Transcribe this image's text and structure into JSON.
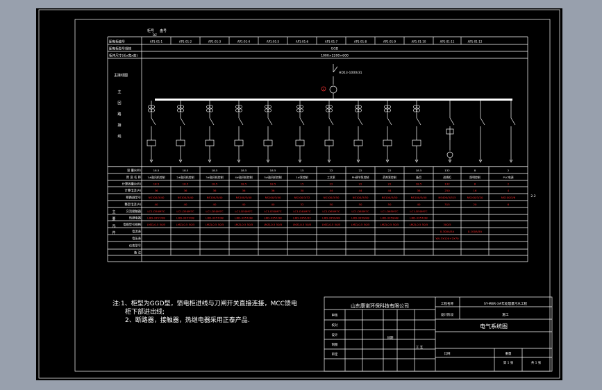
{
  "colors": {
    "background": "#000000",
    "frame": "#ffffff",
    "text": "#ffffff",
    "values": "#ff2a2a",
    "accent": "#ff3333",
    "desktop": "#98a0ad"
  },
  "header": {
    "cabinet_no_label": "柜号",
    "panel_no_label": "盘号",
    "code": "DZ",
    "row1_label": "配电柜编号",
    "row2_label": "配电柜型号规格",
    "row2_value": "GGD",
    "row3_label": "柜体尺寸(长x宽x高)",
    "row3_value": "1000×2200×600",
    "cabinet_ids": [
      "AP1-01-1",
      "AP1-01-2",
      "AP1-01-3",
      "AP1-01-4",
      "AP1-01-5",
      "AP1-01-6",
      "AP1-01-7",
      "AP1-01-8",
      "AP1-01-9",
      "AP1-01-10",
      "AP1-01-11",
      "AP1-01-12"
    ]
  },
  "diagram": {
    "main_label": "主接线图",
    "side_labels": [
      "主",
      "回",
      "路",
      "接",
      "线"
    ],
    "main_switch": "HD13-1000/31",
    "meter_label": "A"
  },
  "table": {
    "rows": [
      {
        "label": "容 量(kW)",
        "values": [
          "18.5",
          "18.5",
          "18.5",
          "18.5",
          "18.5",
          "15",
          "22",
          "22",
          "22",
          "18.5",
          "132",
          "8",
          "2"
        ],
        "red": false
      },
      {
        "label": "用 途 名 称",
        "values": [
          "1#鼓风机控制",
          "2#鼓风机控制",
          "3#鼓风机控制",
          "4#鼓风机控制",
          "5#鼓风机控制",
          "1#泵控制",
          "工艺泵",
          "PH调节泵控制",
          "药剂泵控制",
          "备用",
          "进线柜",
          "照明控制",
          "PLC电源"
        ],
        "red": false
      },
      {
        "label": "计算容量(kW)",
        "values": [
          "18.5",
          "18.5",
          "18.5",
          "18.5",
          "18.5",
          "15",
          "22",
          "22",
          "22",
          "18.5",
          "132",
          "8",
          "2"
        ],
        "red": true
      },
      {
        "label": "计算电流(A)",
        "values": [
          "36",
          "36",
          "36",
          "36",
          "36",
          "30",
          "44",
          "44",
          "44",
          "36",
          "250",
          "16",
          "4"
        ],
        "red": true
      },
      {
        "label": "断路器型号",
        "values": [
          "NS100/3/40",
          "NS100/3/40",
          "NS100/3/40",
          "NS100/3/40",
          "NS100/3/40",
          "NS100/3/32",
          "NS100/3/50",
          "NS100/3/50",
          "NS100/3/50",
          "NS100/3/40",
          "NS400/3/315",
          "NS100/3/20",
          "NS100/3/6"
        ],
        "red": true
      },
      {
        "label": "整定电流(A)",
        "values": [
          "40",
          "40",
          "40",
          "40",
          "40",
          "32",
          "50",
          "50",
          "50",
          "40",
          "315",
          "20",
          "6"
        ],
        "red": true
      },
      {
        "label": "交流接触器",
        "values": [
          "LC1-D50M7C",
          "LC1-D50M7C",
          "LC1-D50M7C",
          "LC1-D50M7C",
          "LC1-D50M7C",
          "LC1-D40M7C",
          "LC1-D65M7C",
          "LC1-D65M7C",
          "LC1-D65M7C",
          "LC1-D50M7C",
          "",
          "",
          ""
        ],
        "red": true
      },
      {
        "label": "热继电器",
        "values": [
          "LRD-3357/38",
          "LRD-3357/38",
          "LRD-3357/38",
          "LRD-3357/38",
          "LRD-3357/38",
          "LRD-3355/32",
          "LRD-3359/48",
          "LRD-3359/48",
          "LRD-3359/48",
          "LRD-3357/38",
          "",
          "",
          ""
        ],
        "red": true
      },
      {
        "label": "电缆型号规格",
        "values": [
          "LMZJ-0.5 50/5",
          "LMZJ-0.5 50/5",
          "LMZJ-0.5 50/5",
          "LMZJ-0.5 50/5",
          "LMZJ-0.5 50/5",
          "LMZJ-0.5 50/5",
          "LMZJ-0.5 50/5",
          "LMZJ-0.5 50/5",
          "LMZJ-0.5 50/5",
          "LMZJ-0.5 50/5",
          "300/5",
          "",
          ""
        ],
        "red": true
      },
      {
        "label": "电流表",
        "values": [
          "",
          "",
          "",
          "",
          "",
          "",
          "",
          "",
          "",
          "",
          "0-300A/5A",
          "0-100A/5A",
          ""
        ],
        "red": true
      },
      {
        "label": "电压表",
        "values": [
          "",
          "",
          "",
          "",
          "",
          "",
          "",
          "",
          "",
          "",
          "YJV-3X120+2X70",
          "",
          ""
        ],
        "red": true
      },
      {
        "label": "仪表型号",
        "values": [
          "",
          "",
          "",
          "",
          "",
          "",
          "",
          "",
          "",
          "",
          "",
          "",
          ""
        ],
        "red": false
      },
      {
        "label": "备 注",
        "values": [
          "",
          "",
          "",
          "",
          "",
          "",
          "",
          "",
          "",
          "",
          "",
          "",
          ""
        ],
        "red": false
      }
    ],
    "group_label_chars": [
      "主",
      "要",
      "元",
      "件"
    ],
    "side_value": "2.2"
  },
  "notes": {
    "line1": "注:1、柜型为GGD型，馈电柜进线与刀闸开关直接连接，MCC馈电",
    "line2": "柜下部进出线;",
    "line3": "2、断路器，接触器，热继电器采用正泰产品."
  },
  "title_block": {
    "company": "山东康诺环保科技有限公司",
    "project_label": "工程名称",
    "project_value": "SY-MBR-3#年处理量污水工程",
    "design_stage_label": "设计阶段",
    "design_stage_value": "施工",
    "drawing_title": "电气系统图",
    "roles": [
      "审核",
      "校对",
      "设计",
      "制图",
      "审定"
    ],
    "scale_label": "比例",
    "weight_label": "重量",
    "sheet_label": "第 1 张",
    "sheet_total": "共 1 张",
    "date_label": "日期",
    "subtitle": "工 艺"
  }
}
